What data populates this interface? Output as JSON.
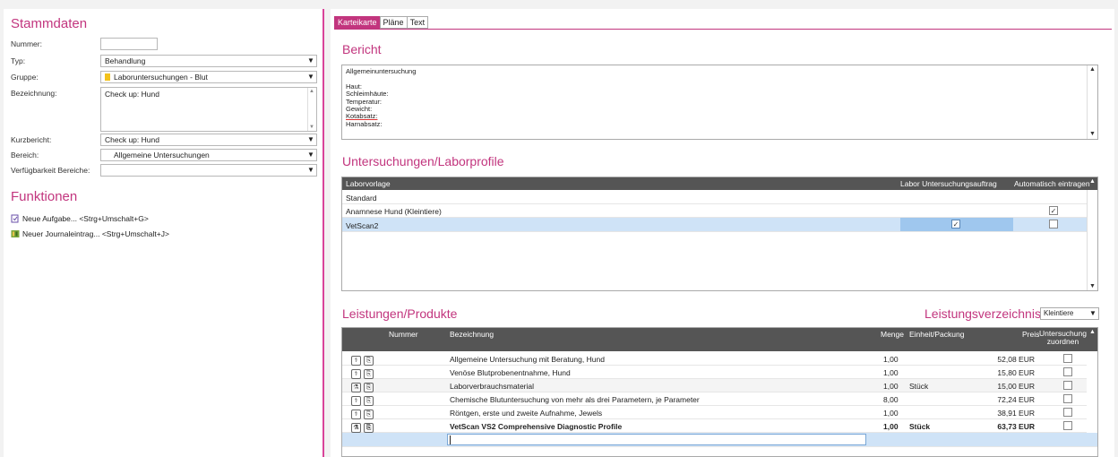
{
  "stammdaten": {
    "title": "Stammdaten",
    "nummer_label": "Nummer:",
    "nummer_value": "",
    "typ_label": "Typ:",
    "typ_value": "Behandlung",
    "gruppe_label": "Gruppe:",
    "gruppe_value": "Laboruntersuchungen - Blut",
    "bezeichnung_label": "Bezeichnung:",
    "bezeichnung_value": "Check up: Hund",
    "kurzbericht_label": "Kurzbericht:",
    "kurzbericht_value": "Check up: Hund",
    "bereich_label": "Bereich:",
    "bereich_value": "Allgemeine Untersuchungen",
    "verfuegbarkeit_label": "Verfügbarkeit Bereiche:",
    "verfuegbarkeit_value": ""
  },
  "funktionen": {
    "title": "Funktionen",
    "items": [
      {
        "label": "Neue Aufgabe... <Strg+Umschalt+G>"
      },
      {
        "label": "Neuer Journaleintrag... <Strg+Umschalt+J>"
      }
    ]
  },
  "tabs": [
    "Karteikarte",
    "Pläne",
    "Text"
  ],
  "bericht": {
    "title": "Bericht",
    "lines": [
      "Allgemeinuntersuchung",
      "",
      "Haut:",
      "Schleimhäute:",
      "Temperatur:",
      "Gewicht:",
      "Kotabsatz:",
      "Harnabsatz:"
    ]
  },
  "laborprofile": {
    "title": "Untersuchungen/Laborprofile",
    "columns": [
      "Laborvorlage",
      "Labor Untersuchungsauftrag",
      "Automatisch eintragen"
    ],
    "rows": [
      {
        "name": "Standard",
        "auftrag": false,
        "auto": false,
        "show_auftrag": false,
        "show_auto": false
      },
      {
        "name": "Anamnese Hund (Kleintiere)",
        "auftrag": false,
        "auto": true,
        "show_auftrag": false,
        "show_auto": true
      },
      {
        "name": "VetScan2",
        "auftrag": true,
        "auto": false,
        "show_auftrag": true,
        "show_auto": true
      }
    ]
  },
  "leistungen": {
    "title": "Leistungen/Produkte",
    "verzeichnis_label": "Leistungsverzeichnis:",
    "verzeichnis_value": "Kleintiere",
    "columns": [
      "Nummer",
      "Bezeichnung",
      "Menge",
      "Einheit/Packung",
      "Preis",
      "Untersuchung zuordnen"
    ],
    "rows": [
      {
        "icon": "treatment-icon",
        "nummer": "",
        "bezeichnung": "Allgemeine Untersuchung mit Beratung, Hund",
        "menge": "1,00",
        "einheit": "",
        "preis": "52,08 EUR",
        "bold": false
      },
      {
        "icon": "treatment-icon",
        "nummer": "",
        "bezeichnung": "Venöse Blutprobenentnahme, Hund",
        "menge": "1,00",
        "einheit": "",
        "preis": "15,80 EUR",
        "bold": false
      },
      {
        "icon": "product-icon",
        "nummer": "",
        "bezeichnung": "Laborverbrauchsmaterial",
        "menge": "1,00",
        "einheit": "Stück",
        "preis": "15,00 EUR",
        "bold": false
      },
      {
        "icon": "treatment-icon",
        "nummer": "",
        "bezeichnung": "Chemische Blutuntersuchung von mehr als drei Parametern, je Parameter",
        "menge": "8,00",
        "einheit": "",
        "preis": "72,24 EUR",
        "bold": false
      },
      {
        "icon": "treatment-icon",
        "nummer": "",
        "bezeichnung": "Röntgen, erste und zweite Aufnahme, Jewels",
        "menge": "1,00",
        "einheit": "",
        "preis": "38,91 EUR",
        "bold": false
      },
      {
        "icon": "product-icon",
        "nummer": "",
        "bezeichnung": "VetScan VS2 Comprehensive Diagnostic Profile",
        "menge": "1,00",
        "einheit": "Stück",
        "preis": "63,73 EUR",
        "bold": true
      }
    ]
  }
}
